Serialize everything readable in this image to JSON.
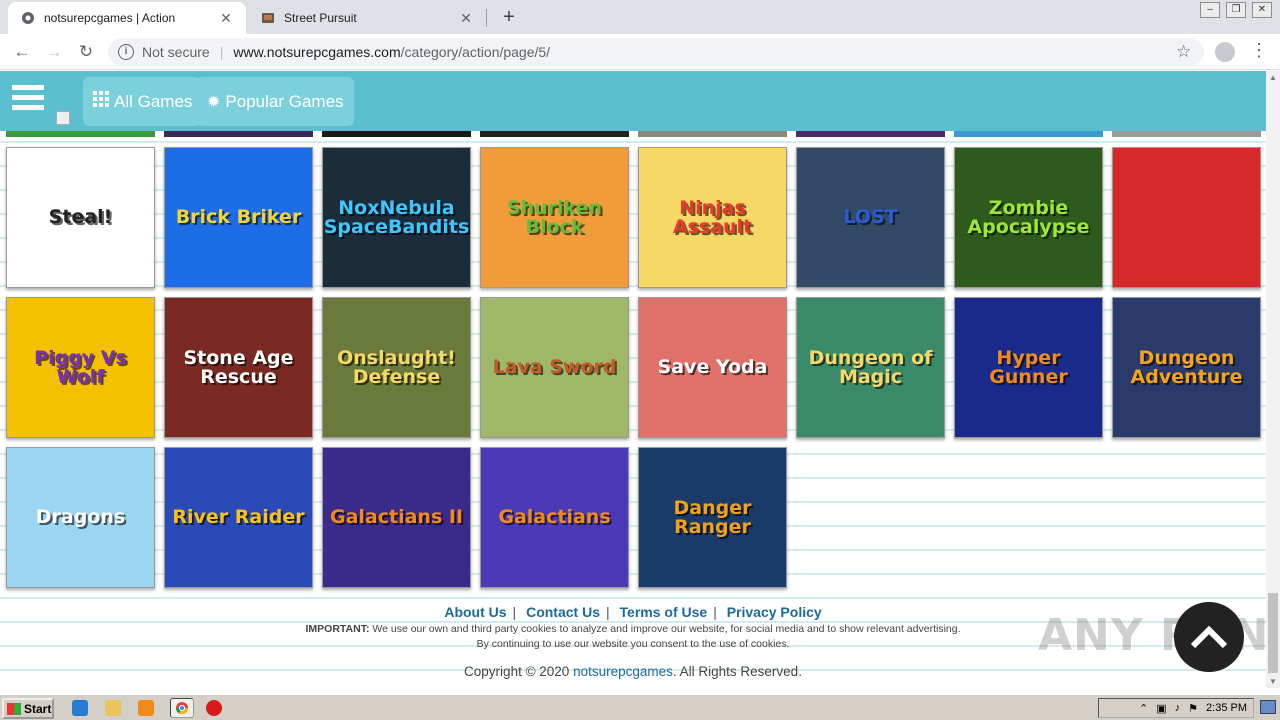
{
  "browser": {
    "tabs": [
      {
        "title": "notsurepcgames | Action",
        "active": true
      },
      {
        "title": "Street Pursuit",
        "active": false
      }
    ],
    "new_tab": "+",
    "url_security": "Not secure",
    "url_domain": "www.notsurepcgames.com",
    "url_path": "/category/action/page/5/",
    "window_controls": {
      "minimize": "–",
      "restore": "❐",
      "close": "✕"
    }
  },
  "site": {
    "nav": [
      {
        "label": "All Games",
        "icon": "grid-icon"
      },
      {
        "label": "Popular Games",
        "icon": "star-burst-icon"
      }
    ]
  },
  "games": [
    {
      "label": "Steal!",
      "bg": "#ffffff",
      "fg": "#222222"
    },
    {
      "label": "Brick Briker",
      "bg": "#1d6ee6",
      "fg": "#f4d23a"
    },
    {
      "label": "NoxNebula SpaceBandits",
      "bg": "#1b2c3a",
      "fg": "#3ec6ff"
    },
    {
      "label": "Shuriken Block",
      "bg": "#f29b3a",
      "fg": "#5fbf3a"
    },
    {
      "label": "Ninjas Assault",
      "bg": "#f7d766",
      "fg": "#e83a2a"
    },
    {
      "label": "LOST",
      "bg": "#324a66",
      "fg": "#2a5bd6"
    },
    {
      "label": "Zombie Apocalypse",
      "bg": "#2f5a1e",
      "fg": "#9be83a"
    },
    {
      "label": "",
      "bg": "#d62a2a",
      "fg": "#ffffff"
    },
    {
      "label": "Piggy Vs Wolf",
      "bg": "#f5c000",
      "fg": "#7a2fb8"
    },
    {
      "label": "Stone Age Rescue",
      "bg": "#7a2a22",
      "fg": "#ffffff"
    },
    {
      "label": "Onslaught! Defense",
      "bg": "#6a7a3a",
      "fg": "#f7d766"
    },
    {
      "label": "Lava Sword",
      "bg": "#9fb86a",
      "fg": "#c85a2a"
    },
    {
      "label": "Save Yoda",
      "bg": "#e0706a",
      "fg": "#ffffff"
    },
    {
      "label": "Dungeon of Magic",
      "bg": "#3a8a6a",
      "fg": "#f7d766"
    },
    {
      "label": "Hyper Gunner",
      "bg": "#1a2a8a",
      "fg": "#f28a1a"
    },
    {
      "label": "Dungeon Adventure",
      "bg": "#2a3a6a",
      "fg": "#f7a21a"
    },
    {
      "label": "Dragons",
      "bg": "#9ad6f2",
      "fg": "#ffffff"
    },
    {
      "label": "River Raider",
      "bg": "#2a4ab8",
      "fg": "#f7c21a"
    },
    {
      "label": "Galactians II",
      "bg": "#3a2a8a",
      "fg": "#f28a1a"
    },
    {
      "label": "Galactians",
      "bg": "#4a3ab8",
      "fg": "#f28a1a"
    },
    {
      "label": "Danger Ranger",
      "bg": "#1a3a6a",
      "fg": "#f2a21a"
    }
  ],
  "footer": {
    "links": [
      "About Us",
      "Contact Us",
      "Terms of Use",
      "Privacy Policy"
    ],
    "important_label": "IMPORTANT:",
    "important_text": "We use our own and third party cookies to analyze and improve our website, for social media and to show relevant advertising.",
    "consent_text": "By continuing to use our website you consent to the use of cookies.",
    "copyright_prefix": "Copyright © 2020",
    "copyright_link": "notsurepcgames",
    "copyright_suffix": ". All Rights Reserved."
  },
  "watermark": "ANY RUN",
  "taskbar": {
    "start_label": "Start",
    "clock": "2:35 PM"
  }
}
